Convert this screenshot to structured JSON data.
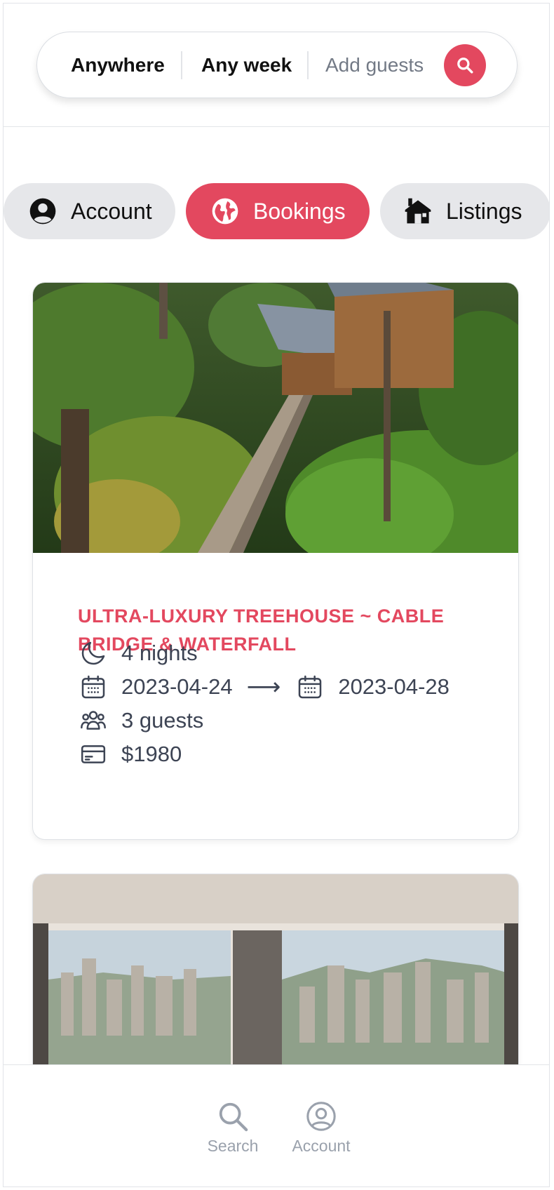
{
  "search_bar": {
    "location": "Anywhere",
    "dates": "Any week",
    "guests_placeholder": "Add guests"
  },
  "tabs": [
    {
      "label": "Account",
      "icon": "user-circle-icon",
      "active": false
    },
    {
      "label": "Bookings",
      "icon": "globe-icon",
      "active": true
    },
    {
      "label": "Listings",
      "icon": "house-icon",
      "active": false
    }
  ],
  "bookings": [
    {
      "title": "ULTRA-LUXURY TREEHOUSE ~ CABLE BRIDGE & WATERFALL",
      "nights": "4 nights",
      "check_in": "2023-04-24",
      "check_out": "2023-04-28",
      "guests": "3 guests",
      "price": "$1980",
      "image": "treehouse-photo"
    },
    {
      "image": "apartment-photo"
    }
  ],
  "bottom_nav": {
    "search_label": "Search",
    "account_label": "Account"
  },
  "colors": {
    "accent": "#e3485f",
    "text": "#3d4454",
    "muted": "#9aa1ac",
    "tab_bg": "#e6e7ea"
  }
}
